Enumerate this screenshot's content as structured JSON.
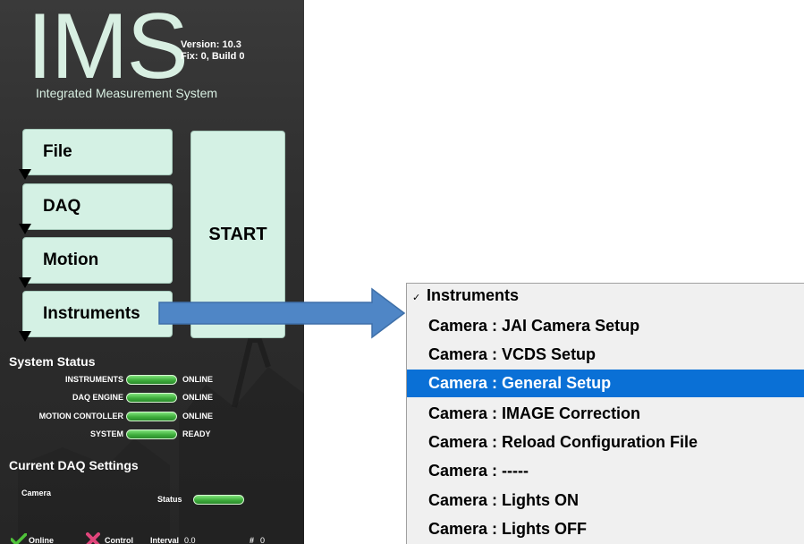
{
  "app": {
    "logo": "IMS",
    "version_line": "Version: 10.3",
    "build_line": "Fix: 0, Build 0",
    "subtitle": "Integrated Measurement System"
  },
  "menu": {
    "file": "File",
    "daq": "DAQ",
    "motion": "Motion",
    "instruments": "Instruments",
    "start": "START"
  },
  "system_status": {
    "title": "System Status",
    "rows": [
      {
        "name": "INSTRUMENTS",
        "value": "ONLINE"
      },
      {
        "name": "DAQ ENGINE",
        "value": "ONLINE"
      },
      {
        "name": "MOTION CONTOLLER",
        "value": "ONLINE"
      },
      {
        "name": "SYSTEM",
        "value": "READY"
      }
    ]
  },
  "daq_settings": {
    "title": "Current DAQ Settings",
    "camera_label": "Camera",
    "status_label": "Status",
    "online_label": "Online",
    "control_label": "Control",
    "interval_label": "Interval",
    "interval_value": "0.0",
    "count_label": "#",
    "count_value": "0"
  },
  "dropdown": {
    "header": "Instruments",
    "header_checked": true,
    "items": [
      "Camera :  JAI Camera Setup",
      "Camera :  VCDS Setup",
      "Camera :  General Setup",
      "Camera :  IMAGE Correction",
      "Camera :  Reload Configuration File",
      "Camera :  -----",
      "Camera :  Lights ON",
      "Camera :  Lights OFF"
    ],
    "selected_index": 2
  },
  "colors": {
    "panel_bg": "#2e2e2e",
    "button_bg": "#d4f1e4",
    "logo_text": "#d8efe2",
    "status_green": "#3fae3d",
    "selection": "#0a70d6",
    "arrow_fill": "#4f86c6",
    "check_green": "#4fc23a",
    "x_red": "#e0457b"
  }
}
